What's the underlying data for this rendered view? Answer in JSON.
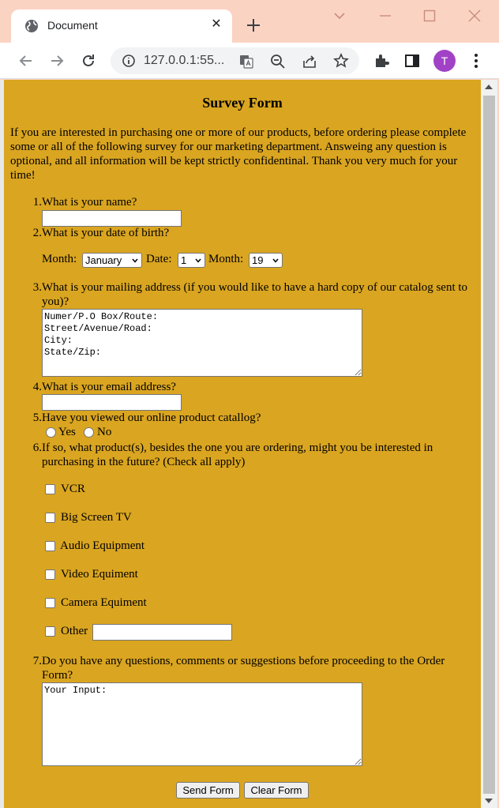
{
  "browser": {
    "tab_title": "Document",
    "url": "127.0.0.1:55...",
    "profile_initial": "T",
    "accent_color": "#a142c6"
  },
  "form": {
    "title": "Survey Form",
    "intro": "If you are interested in purchasing one or more of our products, before ordering please complete some or all of the following survey for our marketing department. Answeing any question is optional, and all information will be kept strictly confidentinal. Thank you very much for your time!",
    "background_color": "#daa520",
    "questions": {
      "q1": {
        "num": "1.",
        "text": "What is your name?",
        "value": ""
      },
      "q2": {
        "num": "2.",
        "text": "What is your date of birth?",
        "month_label": "Month:",
        "month_value": "January",
        "date_label": "Date:",
        "date_value": "1",
        "year_label": "Month:",
        "year_value": "19"
      },
      "q3": {
        "num": "3.",
        "text": "What is your mailing address (if you would like to have a hard copy of our catalog sent to you)?",
        "value": "Numer/P.O Box/Route:\nStreet/Avenue/Road:\nCity:\nState/Zip:"
      },
      "q4": {
        "num": "4.",
        "text": "What is your email address?",
        "value": ""
      },
      "q5": {
        "num": "5.",
        "text": "Have you viewed our online product catallog?",
        "yes": "Yes",
        "no": "No"
      },
      "q6": {
        "num": "6.",
        "text": "If so, what product(s), besides the one you are ordering, might you be interested in purchasing in the future? (Check all apply)",
        "options": [
          "VCR",
          "Big Screen TV",
          "Audio Equipment",
          "Video Equiment",
          "Camera Equiment",
          "Other"
        ],
        "other_value": ""
      },
      "q7": {
        "num": "7.",
        "text": "Do you have any questions, comments or suggestions before proceeding to the Order Form?",
        "value": "Your Input:"
      }
    },
    "send_label": "Send Form",
    "clear_label": "Clear Form"
  }
}
